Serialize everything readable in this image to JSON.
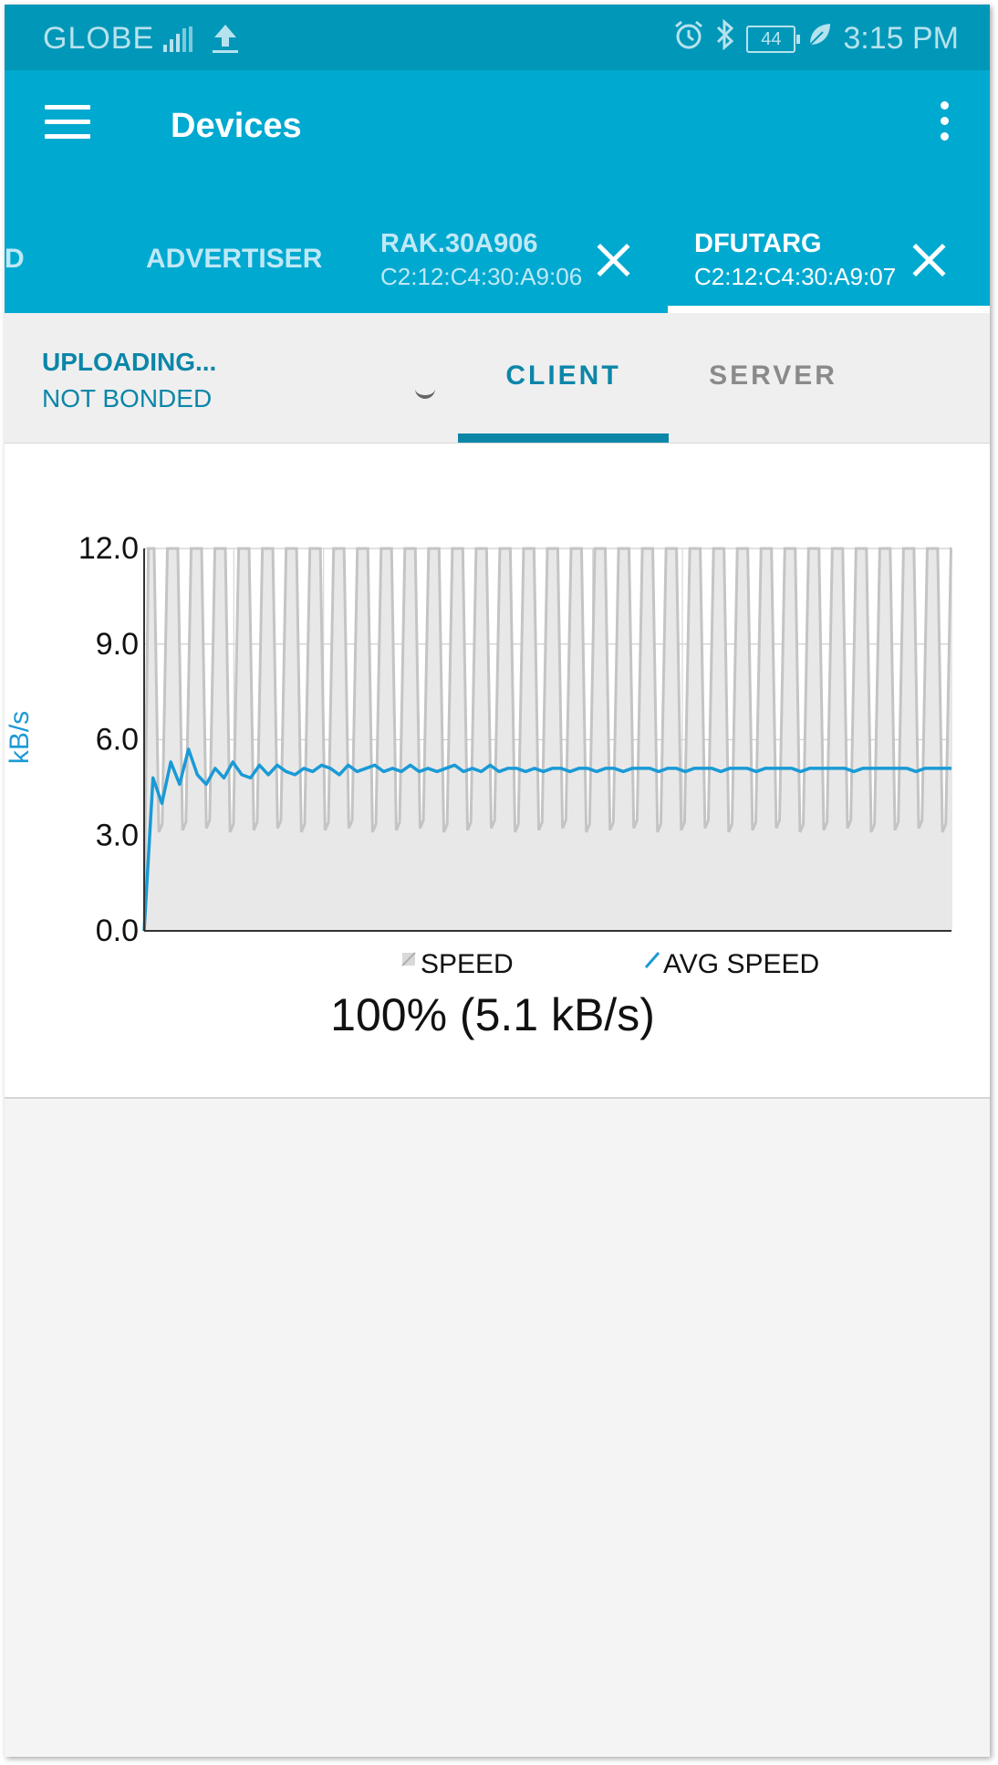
{
  "status_bar": {
    "carrier": "GLOBE",
    "signal_icon": "signal-bars-icon",
    "upload_icon": "upload-arrow-icon",
    "alarm_icon": "alarm-clock-icon",
    "bluetooth_icon": "bluetooth-icon",
    "battery_level": "44",
    "eco_icon": "leaf-icon",
    "time": "3:15 PM"
  },
  "app_bar": {
    "title": "Devices",
    "menu_icon": "hamburger-menu-icon",
    "more_icon": "overflow-menu-icon"
  },
  "device_tabs": {
    "partial_label": "D",
    "items": [
      {
        "name": "ADVERTISER"
      },
      {
        "name": "RAK.30A906",
        "address": "C2:12:C4:30:A9:06"
      },
      {
        "name": "DFUTARG",
        "address": "C2:12:C4:30:A9:07"
      }
    ]
  },
  "connection": {
    "state": "UPLOADING...",
    "bond": "NOT BONDED"
  },
  "role_tabs": {
    "client": "CLIENT",
    "server": "SERVER"
  },
  "progress": {
    "text": "100% (5.1 kB/s)"
  },
  "colors": {
    "status_bar": "#0097b8",
    "app_bar": "#00a9d0",
    "accent": "#0c86a8",
    "avg_line": "#1a9ad6",
    "speed_fill": "#e8e8e8",
    "speed_stroke": "#c4c4c4"
  },
  "chart_data": {
    "type": "area",
    "ylabel": "kB/s",
    "ylim": [
      0,
      12
    ],
    "yticks": [
      "12.0",
      "9.0",
      "6.0",
      "3.0",
      "0.0"
    ],
    "grid": true,
    "legend_position": "bottom",
    "series": [
      {
        "name": "SPEED",
        "kind": "oscillating",
        "cycles": 34,
        "high": 12.0,
        "low": 3.1
      },
      {
        "name": "AVG SPEED",
        "values": [
          0.0,
          4.8,
          4.0,
          5.3,
          4.6,
          5.7,
          4.9,
          4.6,
          5.1,
          4.8,
          5.3,
          4.9,
          4.8,
          5.2,
          4.9,
          5.2,
          5.0,
          4.9,
          5.1,
          5.0,
          5.2,
          5.1,
          4.9,
          5.2,
          5.0,
          5.1,
          5.2,
          5.0,
          5.1,
          5.0,
          5.2,
          5.0,
          5.1,
          5.0,
          5.1,
          5.2,
          5.0,
          5.1,
          5.0,
          5.2,
          5.0,
          5.1,
          5.1,
          5.0,
          5.1,
          5.0,
          5.1,
          5.1,
          5.0,
          5.1,
          5.1,
          5.0,
          5.1,
          5.1,
          5.0,
          5.1,
          5.1,
          5.1,
          5.0,
          5.1,
          5.1,
          5.0,
          5.1,
          5.1,
          5.1,
          5.0,
          5.1,
          5.1,
          5.1,
          5.0,
          5.1,
          5.1,
          5.1,
          5.1,
          5.0,
          5.1,
          5.1,
          5.1,
          5.1,
          5.1,
          5.0,
          5.1,
          5.1,
          5.1,
          5.1,
          5.1,
          5.1,
          5.0,
          5.1,
          5.1,
          5.1,
          5.1
        ]
      }
    ]
  }
}
